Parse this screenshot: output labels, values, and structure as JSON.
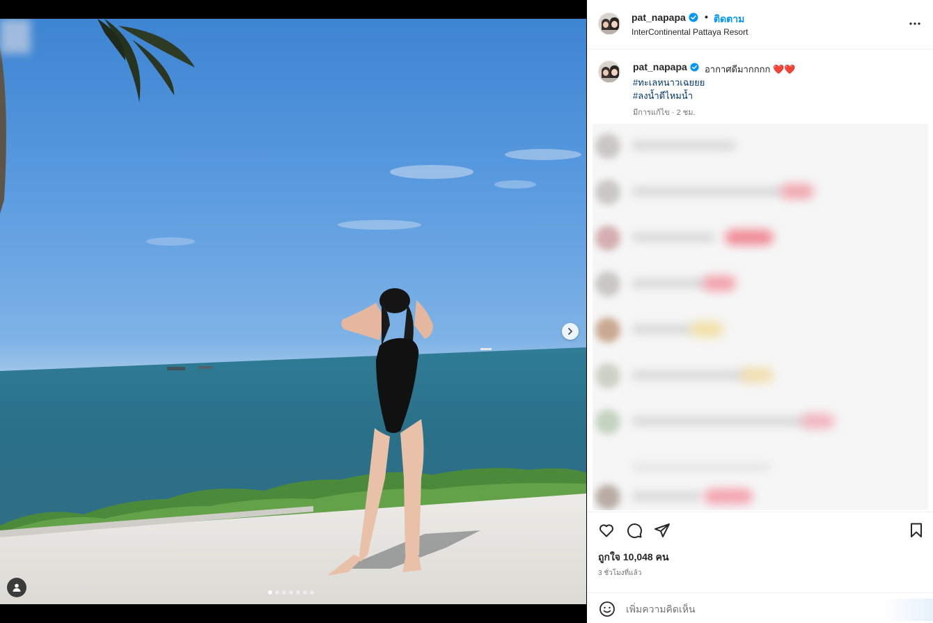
{
  "post": {
    "username": "pat_napapa",
    "separator": "•",
    "follow_label": "ติดตาม",
    "location": "InterContinental Pattaya Resort",
    "more_icon": "more-horizontal-icon",
    "verified_color": "#0095f6"
  },
  "caption": {
    "username": "pat_napapa",
    "text": "อากาศดีมากกกก",
    "emojis": "❤️❤️",
    "hashtags": [
      "#ทะเลหนาวเฉยยย",
      "#ลงน้ำดีไหมน้ำ"
    ],
    "meta": "มีการแก้ไข · 2 ชม."
  },
  "media": {
    "slide_count": 7,
    "active_slide": 1,
    "next_icon": "chevron-right-icon",
    "user_tag_icon": "user-icon"
  },
  "engagement": {
    "likes_text": "ถูกใจ 10,048 คน",
    "time_ago": "3 ชั่วโมงที่แล้ว"
  },
  "comment_box": {
    "placeholder": "เพิ่มความคิดเห็น"
  },
  "icons": {
    "like": "heart-icon",
    "comment": "comment-icon",
    "share": "send-icon",
    "save": "bookmark-icon",
    "emoji": "smile-icon"
  },
  "colors": {
    "accent": "#0095f6",
    "hashtag": "#00376b",
    "text": "#262626",
    "secondary": "#737373"
  }
}
